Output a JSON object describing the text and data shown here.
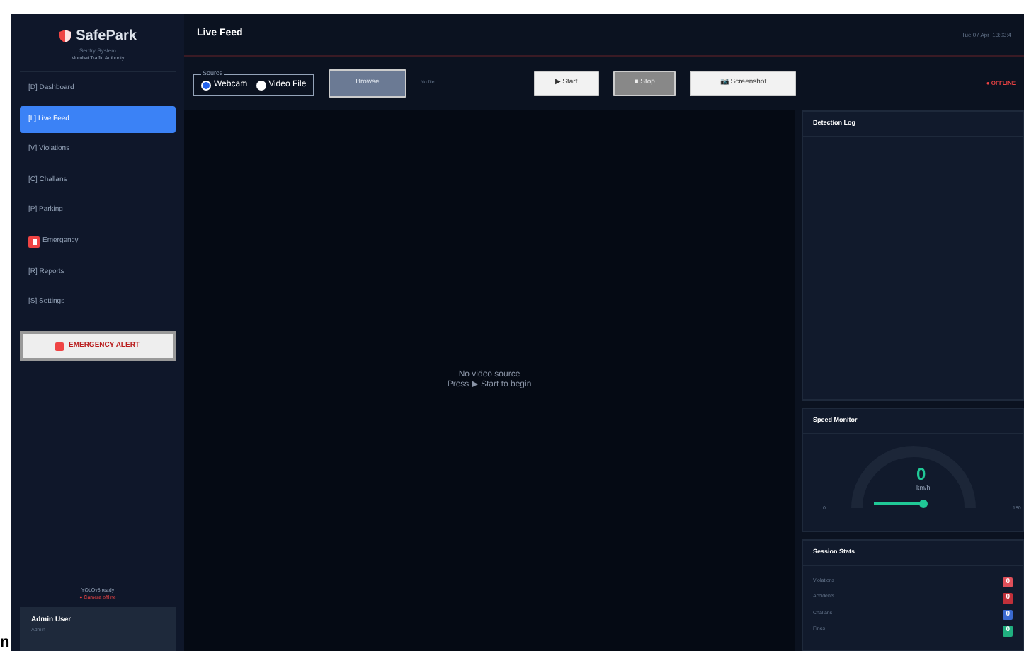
{
  "sidebar": {
    "brand": "SafePark",
    "subtitle": "Sentry System",
    "org": "Mumbai Traffic Authority",
    "items": [
      {
        "label": "[D] Dashboard",
        "selected": false,
        "kind": "text"
      },
      {
        "label": "[L] Live Feed",
        "selected": true,
        "kind": "text"
      },
      {
        "label": "[V] Violations",
        "selected": false,
        "kind": "text"
      },
      {
        "label": "[C] Challans",
        "selected": false,
        "kind": "text"
      },
      {
        "label": "[P] Parking",
        "selected": false,
        "kind": "text"
      },
      {
        "label": "Emergency",
        "selected": false,
        "kind": "icon"
      },
      {
        "label": "[R] Reports",
        "selected": false,
        "kind": "text"
      },
      {
        "label": "[S] Settings",
        "selected": false,
        "kind": "text"
      }
    ],
    "alert_button": "EMERGENCY ALERT",
    "model_status": "YOLOv8 ready",
    "camera_status": "● Camera offline",
    "user": {
      "name": "Admin User",
      "role": "Admin"
    }
  },
  "header": {
    "title": "Live Feed",
    "datetime": "Tue 07 Apr  13:03:4"
  },
  "toolbar": {
    "source_legend": "Source",
    "sources": [
      {
        "label": "Webcam",
        "selected": true
      },
      {
        "label": "Video File",
        "selected": false
      }
    ],
    "browse": {
      "label": "Browse",
      "disabled": true
    },
    "file_name": "No file",
    "buttons": [
      {
        "label": "▶ Start",
        "kind": "start",
        "disabled": false
      },
      {
        "label": "■ Stop",
        "kind": "stop",
        "disabled": true
      },
      {
        "label": "📷 Screenshot",
        "kind": "shot",
        "disabled": false
      }
    ],
    "status": "● OFFLINE"
  },
  "video": {
    "line1": "No video source",
    "line2": "Press ▶ Start to begin"
  },
  "detection_log": {
    "title": "Detection Log"
  },
  "speed_monitor": {
    "title": "Speed Monitor",
    "value": "0",
    "unit": "km/h",
    "min": "0",
    "max": "180"
  },
  "session_stats": {
    "title": "Session Stats",
    "rows": [
      {
        "label": "Violations",
        "value": "0",
        "color": "#e0505a"
      },
      {
        "label": "Accidents",
        "value": "0",
        "color": "#c0303a"
      },
      {
        "label": "Challans",
        "value": "0",
        "color": "#3a6ad0"
      },
      {
        "label": "Fines",
        "value": "0",
        "color": "#20b080"
      }
    ]
  },
  "page_fragment": "n"
}
